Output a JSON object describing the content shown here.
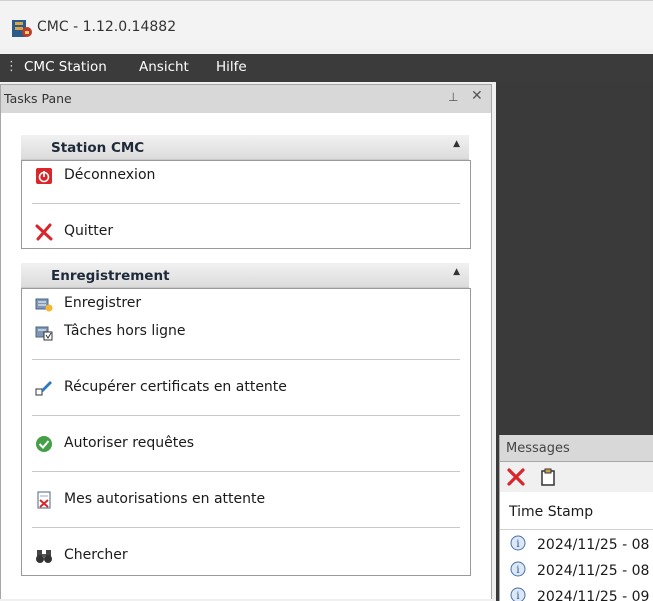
{
  "titlebar": {
    "title": "CMC - 1.12.0.14882",
    "icon": "cmc-app-icon"
  },
  "menubar": {
    "items": [
      {
        "label": "CMC Station"
      },
      {
        "label": "Ansicht"
      },
      {
        "label": "Hilfe"
      }
    ]
  },
  "tasks_pane": {
    "title": "Tasks Pane",
    "groups": [
      {
        "title": "Station CMC",
        "items": [
          {
            "label": "Déconnexion",
            "icon": "power-icon"
          },
          {
            "label": "Quitter",
            "icon": "red-x-icon"
          }
        ]
      },
      {
        "title": "Enregistrement",
        "items": [
          {
            "label": "Enregistrer",
            "icon": "register-icon"
          },
          {
            "label": "Tâches hors ligne",
            "icon": "offline-tasks-icon"
          },
          {
            "label": "Récupérer certificats en attente",
            "icon": "retrieve-certificates-icon"
          },
          {
            "label": "Autoriser requêtes",
            "icon": "green-check-icon"
          },
          {
            "label": "Mes autorisations en attente",
            "icon": "pending-authorizations-icon"
          },
          {
            "label": "Chercher",
            "icon": "binoculars-icon"
          }
        ]
      }
    ]
  },
  "messages": {
    "title": "Messages",
    "columns": [
      "Time Stamp"
    ],
    "rows": [
      {
        "time": "2024/11/25 - 08",
        "icon": "info-icon"
      },
      {
        "time": "2024/11/25 - 08",
        "icon": "info-icon"
      },
      {
        "time": "2024/11/25 - 09",
        "icon": "info-icon"
      }
    ]
  },
  "colors": {
    "menubar_bg": "#3b3b3b",
    "workspace_bg": "#3a3a3a",
    "pane_header_bg": "#d8d8d8",
    "accent_red": "#d9262b"
  }
}
